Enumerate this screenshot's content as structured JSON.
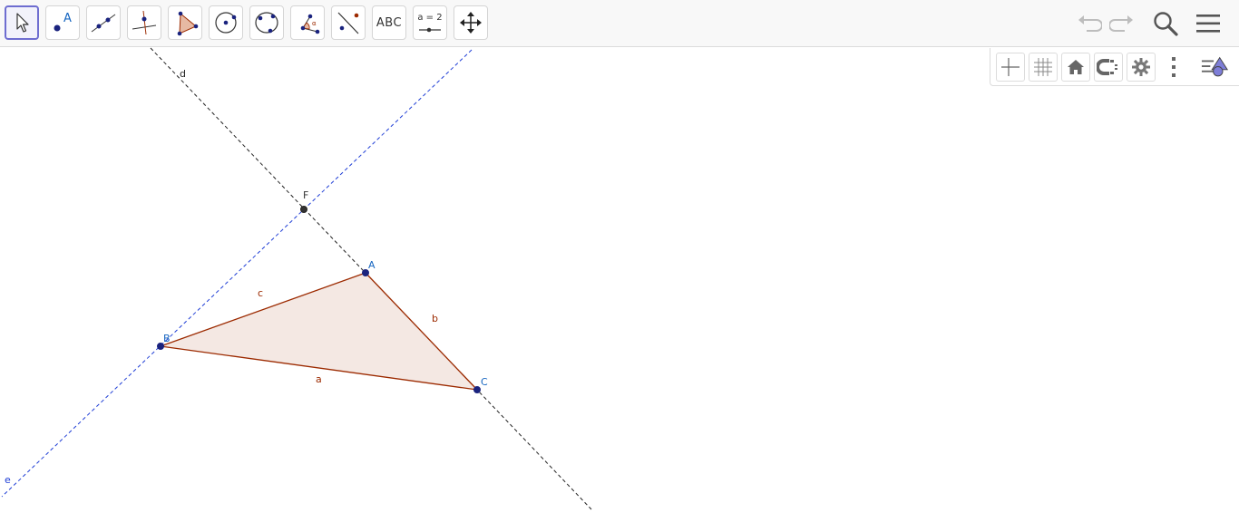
{
  "toolbar": {
    "tools": [
      {
        "name": "Move",
        "icon": "move-arrow-icon",
        "active": true
      },
      {
        "name": "Point",
        "icon": "point-icon",
        "label": "A"
      },
      {
        "name": "Line",
        "icon": "line-icon"
      },
      {
        "name": "Perpendicular Line",
        "icon": "perpendicular-line-icon"
      },
      {
        "name": "Polygon",
        "icon": "polygon-icon"
      },
      {
        "name": "Circle with Center",
        "icon": "circle-icon"
      },
      {
        "name": "Circle through 3 Points",
        "icon": "circle-three-points-icon"
      },
      {
        "name": "Angle",
        "icon": "angle-icon"
      },
      {
        "name": "Reflect about Line",
        "icon": "reflect-icon"
      },
      {
        "name": "Text",
        "icon": "text-icon",
        "label": "ABC"
      },
      {
        "name": "Slider",
        "icon": "slider-icon",
        "label": "a = 2"
      },
      {
        "name": "Move Graphics View",
        "icon": "move-view-icon"
      }
    ],
    "undo_icon": "undo-icon",
    "redo_icon": "redo-icon",
    "search_icon": "search-icon",
    "menu_icon": "hamburger-menu-icon"
  },
  "style_bar": {
    "buttons": [
      {
        "icon": "axes-icon"
      },
      {
        "icon": "grid-icon"
      },
      {
        "icon": "home-icon"
      },
      {
        "icon": "magnet-snap-icon"
      },
      {
        "icon": "gear-icon"
      },
      {
        "icon": "more-vertical-icon"
      },
      {
        "icon": "algebra-view-toggle-icon"
      }
    ]
  },
  "construction": {
    "points": [
      {
        "name": "A",
        "color": "#1565c0"
      },
      {
        "name": "B",
        "color": "#1565c0"
      },
      {
        "name": "C",
        "color": "#1565c0"
      },
      {
        "name": "F",
        "color": "#333333"
      }
    ],
    "segments": [
      {
        "name": "a",
        "color": "#9c2a00"
      },
      {
        "name": "b",
        "color": "#9c2a00"
      },
      {
        "name": "c",
        "color": "#9c2a00"
      }
    ],
    "lines": [
      {
        "name": "d",
        "color": "#222222"
      },
      {
        "name": "e",
        "color": "#1f3ed6"
      }
    ],
    "polygon_fill": "#f3e5e0",
    "polygon_stroke": "#9c2a00",
    "accent": "#6e6dd0"
  }
}
